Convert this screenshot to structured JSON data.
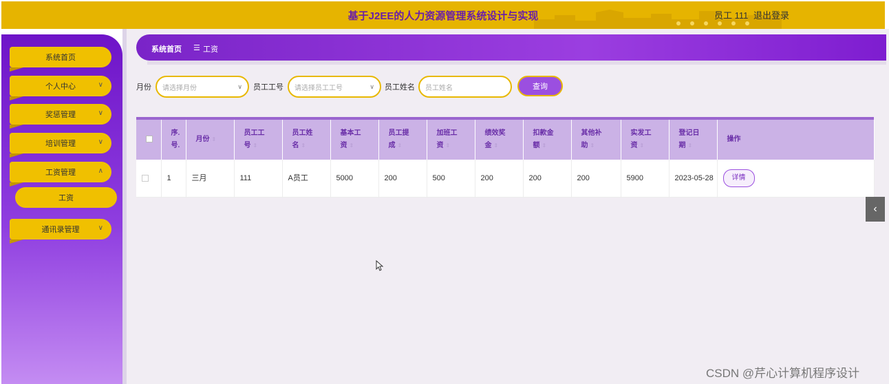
{
  "header": {
    "title": "基于J2EE的人力资源管理系统设计与实现",
    "user": "员工 111",
    "logout": "退出登录"
  },
  "sidebar": {
    "items": [
      {
        "label": "系统首页",
        "chevron": ""
      },
      {
        "label": "个人中心",
        "chevron": "∨"
      },
      {
        "label": "奖惩管理",
        "chevron": "∨"
      },
      {
        "label": "培训管理",
        "chevron": "∨"
      },
      {
        "label": "工资管理",
        "chevron": "∧"
      },
      {
        "label": "通讯录管理",
        "chevron": "∨"
      }
    ],
    "subitem": "工资"
  },
  "breadcrumb": {
    "home": "系统首页",
    "separator": "☰",
    "current": "工资"
  },
  "search": {
    "month_label": "月份",
    "month_placeholder": "请选择月份",
    "empno_label": "员工工号",
    "empno_placeholder": "请选择员工工号",
    "name_label": "员工姓名",
    "name_placeholder": "员工姓名",
    "button": "查询"
  },
  "table": {
    "headers": [
      {
        "line1": "序.",
        "line2": "号."
      },
      {
        "line1": "月份",
        "line2": ""
      },
      {
        "line1": "员工工",
        "line2": "号"
      },
      {
        "line1": "员工姓",
        "line2": "名"
      },
      {
        "line1": "基本工",
        "line2": "资"
      },
      {
        "line1": "员工提",
        "line2": "成"
      },
      {
        "line1": "加班工",
        "line2": "资"
      },
      {
        "line1": "绩效奖",
        "line2": "金"
      },
      {
        "line1": "扣款金",
        "line2": "额"
      },
      {
        "line1": "其他补",
        "line2": "助"
      },
      {
        "line1": "实发工",
        "line2": "资"
      },
      {
        "line1": "登记日",
        "line2": "期"
      },
      {
        "line1": "操作",
        "line2": ""
      }
    ],
    "rows": [
      {
        "index": "1",
        "month": "三月",
        "empno": "111",
        "name": "A员工",
        "base": "5000",
        "commission": "200",
        "overtime": "500",
        "bonus": "200",
        "deduction": "200",
        "allowance": "200",
        "net": "5900",
        "date": "2023-05-28",
        "action": "详情"
      }
    ]
  },
  "watermark": "CSDN @芹心计算机程序设计",
  "colors": {
    "header_bg": "#e6b400",
    "title_text": "#6a1ea8",
    "sidebar_purple": "#7a24c8",
    "menu_yellow": "#f0c000",
    "table_header": "#cbb2e6"
  }
}
